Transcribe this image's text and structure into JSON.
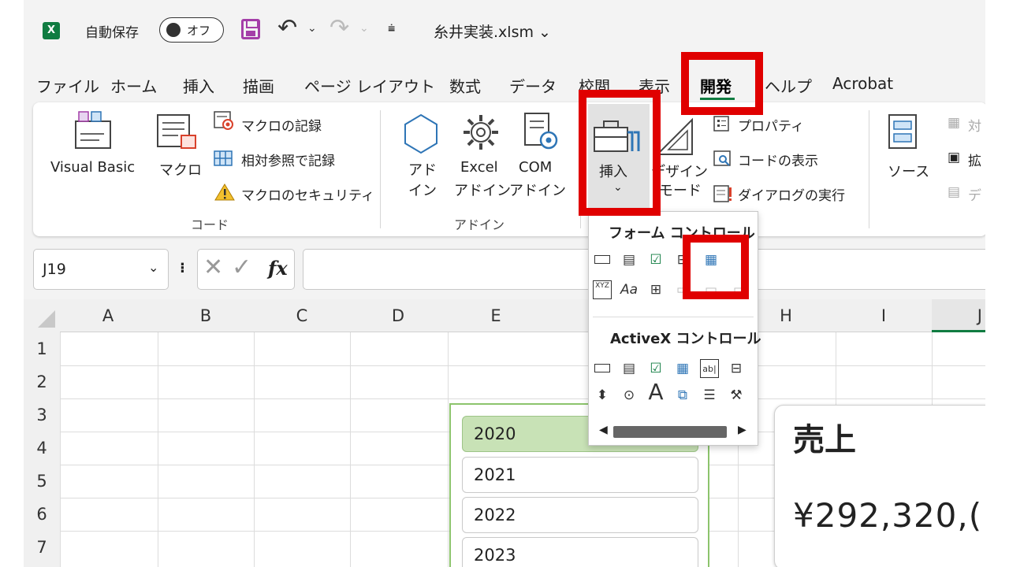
{
  "title_bar": {
    "app_icon": "X",
    "autosave_label": "自動保存",
    "autosave_toggle": "オフ",
    "filename": "糸井実装.xlsm ⌄"
  },
  "menu_tabs": [
    "ファイル",
    "ホーム",
    "挿入",
    "描画",
    "ページ レイアウト",
    "数式",
    "データ",
    "校閲",
    "表示",
    "開発",
    "ヘルプ",
    "Acrobat"
  ],
  "ribbon": {
    "code_group": {
      "visual_basic": "Visual Basic",
      "macro": "マクロ",
      "record_macro": "マクロの記録",
      "relative_ref": "相対参照で記録",
      "macro_security": "マクロのセキュリティ",
      "group_label": "コード"
    },
    "addin_group": {
      "addin_line1": "アド",
      "addin_line2": "イン",
      "excel_line1": "Excel",
      "excel_line2": "アドイン",
      "com_line1": "COM",
      "com_line2": "アドイン",
      "group_label": "アドイン"
    },
    "controls_group": {
      "insert": "挿入",
      "design_line1": "デザイン",
      "design_line2": "モード",
      "properties": "プロパティ",
      "view_code": "コードの表示",
      "run_dialog": "ダイアログの実行"
    },
    "xml_group": {
      "source": "ソース",
      "map": "対",
      "expand": "拡",
      "data": "デ"
    }
  },
  "formula_bar": {
    "name_box": "J19",
    "fx": "fx"
  },
  "columns": [
    "A",
    "B",
    "C",
    "D",
    "E",
    "",
    "H",
    "I",
    "J"
  ],
  "rows": [
    "1",
    "2",
    "3",
    "4",
    "5",
    "6",
    "7"
  ],
  "listbox_items": [
    "2020",
    "2021",
    "2022",
    "2023"
  ],
  "sales_card": {
    "title": "売上",
    "value": "¥292,320,("
  },
  "insert_dropdown": {
    "form_controls_header": "フォーム コントロール",
    "activex_controls_header": "ActiveX コントロール",
    "label_xyz": "XYZ",
    "label_aa": "Aa",
    "label_a": "A"
  },
  "colors": {
    "accent": "#107c41",
    "highlight": "#e00000",
    "selected_item": "#c8e2b6",
    "macro_purple": "#a43ea8"
  }
}
